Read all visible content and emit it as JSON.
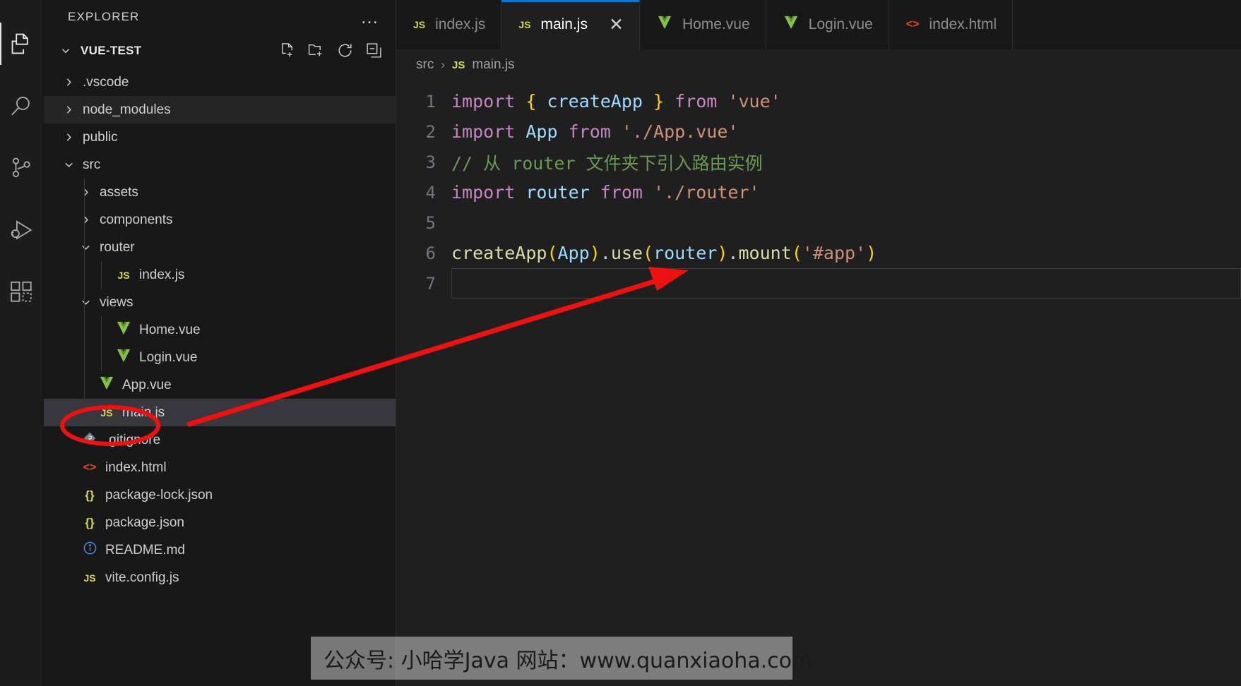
{
  "activitybar": {
    "items": [
      {
        "name": "explorer-icon",
        "title": "Explorer",
        "active": true
      },
      {
        "name": "search-icon",
        "title": "Search",
        "active": false
      },
      {
        "name": "source-control-icon",
        "title": "Source Control",
        "active": false
      },
      {
        "name": "run-debug-icon",
        "title": "Run and Debug",
        "active": false
      },
      {
        "name": "extensions-icon",
        "title": "Extensions",
        "active": false
      }
    ]
  },
  "sidebar": {
    "title": "EXPLORER",
    "more_actions": "…",
    "root": {
      "name": "VUE-TEST",
      "expanded": true,
      "actions": [
        "new-file-icon",
        "new-folder-icon",
        "refresh-icon",
        "collapse-all-icon"
      ]
    },
    "tree": [
      {
        "label": ".vscode",
        "kind": "folder",
        "expanded": false,
        "depth": 1,
        "icon": "chevron-right",
        "state": "normal"
      },
      {
        "label": "node_modules",
        "kind": "folder",
        "expanded": false,
        "depth": 1,
        "icon": "chevron-right",
        "state": "hover"
      },
      {
        "label": "public",
        "kind": "folder",
        "expanded": false,
        "depth": 1,
        "icon": "chevron-right",
        "state": "normal"
      },
      {
        "label": "src",
        "kind": "folder",
        "expanded": true,
        "depth": 1,
        "icon": "chevron-down",
        "state": "normal"
      },
      {
        "label": "assets",
        "kind": "folder",
        "expanded": false,
        "depth": 2,
        "icon": "chevron-right",
        "state": "normal"
      },
      {
        "label": "components",
        "kind": "folder",
        "expanded": false,
        "depth": 2,
        "icon": "chevron-right",
        "state": "normal"
      },
      {
        "label": "router",
        "kind": "folder",
        "expanded": true,
        "depth": 2,
        "icon": "chevron-down",
        "state": "normal"
      },
      {
        "label": "index.js",
        "kind": "file",
        "depth": 3,
        "icon": "js-icon",
        "state": "normal"
      },
      {
        "label": "views",
        "kind": "folder",
        "expanded": true,
        "depth": 2,
        "icon": "chevron-down",
        "state": "normal"
      },
      {
        "label": "Home.vue",
        "kind": "file",
        "depth": 3,
        "icon": "vue-icon",
        "state": "normal"
      },
      {
        "label": "Login.vue",
        "kind": "file",
        "depth": 3,
        "icon": "vue-icon",
        "state": "normal"
      },
      {
        "label": "App.vue",
        "kind": "file",
        "depth": 2,
        "icon": "vue-icon",
        "state": "normal"
      },
      {
        "label": "main.js",
        "kind": "file",
        "depth": 2,
        "icon": "js-icon",
        "state": "selected"
      },
      {
        "label": ".gitignore",
        "kind": "file",
        "depth": 1,
        "icon": "git-icon",
        "state": "normal"
      },
      {
        "label": "index.html",
        "kind": "file",
        "depth": 1,
        "icon": "html-icon",
        "state": "normal"
      },
      {
        "label": "package-lock.json",
        "kind": "file",
        "depth": 1,
        "icon": "json-icon",
        "state": "normal"
      },
      {
        "label": "package.json",
        "kind": "file",
        "depth": 1,
        "icon": "json-icon",
        "state": "normal"
      },
      {
        "label": "README.md",
        "kind": "file",
        "depth": 1,
        "icon": "md-icon",
        "state": "normal"
      },
      {
        "label": "vite.config.js",
        "kind": "file",
        "depth": 1,
        "icon": "js-icon",
        "state": "normal"
      }
    ]
  },
  "editor": {
    "tabs": [
      {
        "label": "index.js",
        "icon": "js-icon",
        "active": false,
        "closable": false
      },
      {
        "label": "main.js",
        "icon": "js-icon",
        "active": true,
        "closable": true,
        "close_glyph": "✕"
      },
      {
        "label": "Home.vue",
        "icon": "vue-icon",
        "active": false,
        "closable": false
      },
      {
        "label": "Login.vue",
        "icon": "vue-icon",
        "active": false,
        "closable": false
      },
      {
        "label": "index.html",
        "icon": "html-icon",
        "active": false,
        "closable": false
      }
    ],
    "breadcrumb": {
      "items": [
        "src",
        "main.js"
      ],
      "separator": "›",
      "file_icon": "js-icon"
    },
    "lines": [
      {
        "num": "1",
        "tokens": [
          {
            "t": "import",
            "c": "kw"
          },
          {
            "t": " ",
            "c": "punct"
          },
          {
            "t": "{",
            "c": "brace"
          },
          {
            "t": " ",
            "c": "punct"
          },
          {
            "t": "createApp",
            "c": "ident"
          },
          {
            "t": " ",
            "c": "punct"
          },
          {
            "t": "}",
            "c": "brace"
          },
          {
            "t": " ",
            "c": "punct"
          },
          {
            "t": "from",
            "c": "kw"
          },
          {
            "t": " ",
            "c": "punct"
          },
          {
            "t": "'vue'",
            "c": "str"
          }
        ]
      },
      {
        "num": "2",
        "tokens": [
          {
            "t": "import",
            "c": "kw"
          },
          {
            "t": " ",
            "c": "punct"
          },
          {
            "t": "App",
            "c": "ident"
          },
          {
            "t": " ",
            "c": "punct"
          },
          {
            "t": "from",
            "c": "kw"
          },
          {
            "t": " ",
            "c": "punct"
          },
          {
            "t": "'./App.vue'",
            "c": "str"
          }
        ]
      },
      {
        "num": "3",
        "tokens": [
          {
            "t": "// 从 router 文件夹下引入路由实例",
            "c": "cmt"
          }
        ]
      },
      {
        "num": "4",
        "tokens": [
          {
            "t": "import",
            "c": "kw"
          },
          {
            "t": " ",
            "c": "punct"
          },
          {
            "t": "router",
            "c": "ident"
          },
          {
            "t": " ",
            "c": "punct"
          },
          {
            "t": "from",
            "c": "kw"
          },
          {
            "t": " ",
            "c": "punct"
          },
          {
            "t": "'./router'",
            "c": "str"
          }
        ]
      },
      {
        "num": "5",
        "tokens": []
      },
      {
        "num": "6",
        "tokens": [
          {
            "t": "createApp",
            "c": "fn"
          },
          {
            "t": "(",
            "c": "paren1"
          },
          {
            "t": "App",
            "c": "ident"
          },
          {
            "t": ")",
            "c": "paren1"
          },
          {
            "t": ".",
            "c": "punct"
          },
          {
            "t": "use",
            "c": "fn"
          },
          {
            "t": "(",
            "c": "paren1"
          },
          {
            "t": "router",
            "c": "ident"
          },
          {
            "t": ")",
            "c": "paren1"
          },
          {
            "t": ".",
            "c": "punct"
          },
          {
            "t": "mount",
            "c": "fn"
          },
          {
            "t": "(",
            "c": "paren1"
          },
          {
            "t": "'#app'",
            "c": "str"
          },
          {
            "t": ")",
            "c": "paren1"
          }
        ]
      },
      {
        "num": "7",
        "tokens": []
      }
    ]
  },
  "annotations": {
    "ellipse_target": "main.js",
    "arrow_from": "main.js",
    "arrow_to": "line-7",
    "color": "#ee1111"
  },
  "watermark": {
    "text": "公众号: 小哈学Java  网站：www.quanxiaoha.com"
  },
  "colors": {
    "accent": "#0078d4",
    "editor_bg": "#1f1f1f",
    "sidebar_bg": "#181818",
    "activitybar_bg": "#1c1c1c",
    "selected_row": "#37373d",
    "annotation_red": "#ee1111"
  }
}
